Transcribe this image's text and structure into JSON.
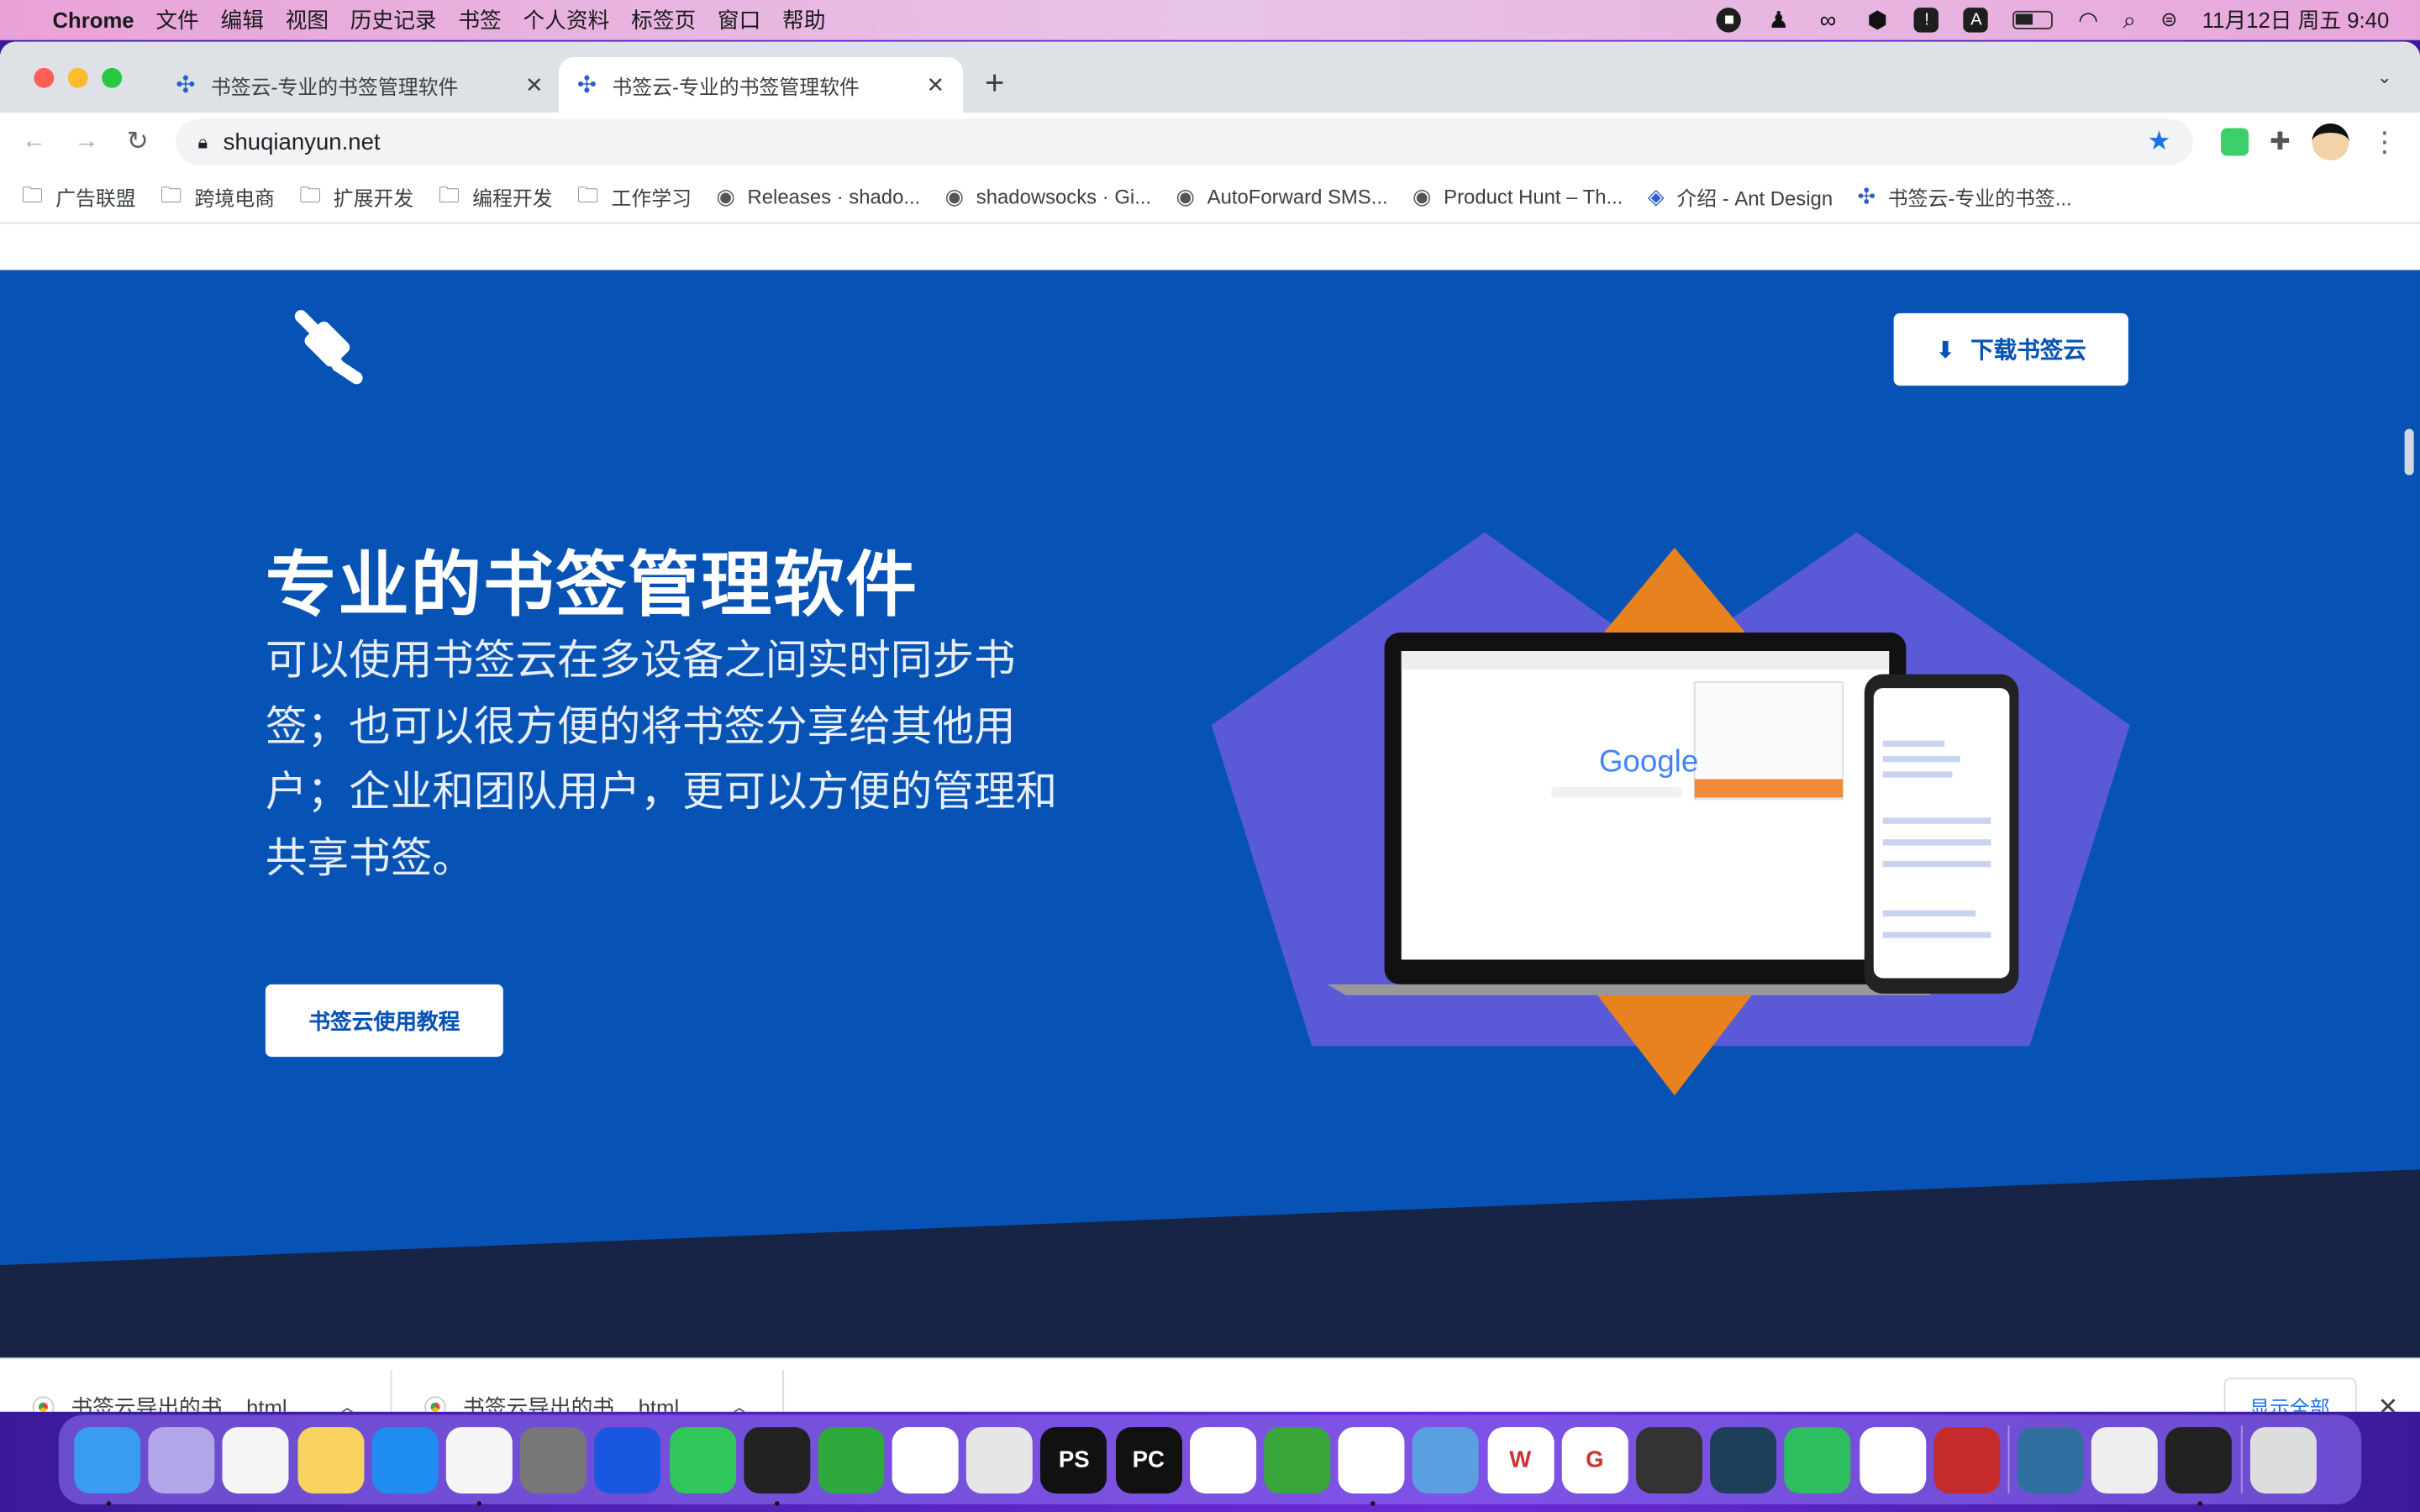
{
  "menubar": {
    "app": "Chrome",
    "items": [
      "文件",
      "编辑",
      "视图",
      "历史记录",
      "书签",
      "个人资料",
      "标签页",
      "窗口",
      "帮助"
    ],
    "clock": "11月12日 周五 9:40",
    "status_icons": [
      "record-icon",
      "qq-icon",
      "creative-cloud-icon",
      "hexagon-icon",
      "alert-icon",
      "input-method-icon",
      "battery-icon",
      "wifi-icon",
      "search-icon",
      "control-center-icon"
    ]
  },
  "tabs": [
    {
      "title": "书签云-专业的书签管理软件",
      "active": false
    },
    {
      "title": "书签云-专业的书签管理软件",
      "active": true
    }
  ],
  "toolbar": {
    "url": "shuqianyun.net"
  },
  "bookmarks": [
    {
      "label": "广告联盟",
      "type": "folder"
    },
    {
      "label": "跨境电商",
      "type": "folder"
    },
    {
      "label": "扩展开发",
      "type": "folder"
    },
    {
      "label": "编程开发",
      "type": "folder"
    },
    {
      "label": "工作学习",
      "type": "folder"
    },
    {
      "label": "Releases · shado...",
      "type": "globe"
    },
    {
      "label": "shadowsocks · Gi...",
      "type": "globe"
    },
    {
      "label": "AutoForward SMS...",
      "type": "globe"
    },
    {
      "label": "Product Hunt – Th...",
      "type": "globe"
    },
    {
      "label": "介绍 - Ant Design",
      "type": "ant"
    },
    {
      "label": "书签云-专业的书签...",
      "type": "shuqianyun"
    }
  ],
  "page": {
    "download_button": "下载书签云",
    "title": "专业的书签管理软件",
    "description": "可以使用书签云在多设备之间实时同步书签；也可以很方便的将书签分享给其他用户；企业和团队用户，更可以方便的管理和共享书签。",
    "tutorial_button": "书签云使用教程",
    "mockup_text": "Google",
    "colors": {
      "primary": "#0753b5",
      "dark": "#172445",
      "accent": "#e8821e",
      "shape": "#5a5ad8"
    }
  },
  "downloads": {
    "items": [
      "书签云导出的书....html",
      "书签云导出的书....html"
    ],
    "show_all": "显示全部"
  },
  "dock": [
    {
      "name": "finder",
      "color": "#3a9cf0",
      "running": true
    },
    {
      "name": "launchpad",
      "color": "#b3a6e8"
    },
    {
      "name": "reminders",
      "color": "#f5f5f5"
    },
    {
      "name": "notes",
      "color": "#f7d25c"
    },
    {
      "name": "app-store",
      "color": "#1e8cf0"
    },
    {
      "name": "chrome",
      "color": "#f5f5f5",
      "running": true
    },
    {
      "name": "system-preferences",
      "color": "#777"
    },
    {
      "name": "maps-pin",
      "color": "#1957e0"
    },
    {
      "name": "wechat",
      "color": "#2fc75a"
    },
    {
      "name": "qq",
      "color": "#222",
      "running": true
    },
    {
      "name": "h-editor",
      "color": "#2eaa3c"
    },
    {
      "name": "xcode-instruments",
      "color": "#fff"
    },
    {
      "name": "messages-terminal",
      "color": "#e6e6e6"
    },
    {
      "name": "phpstorm",
      "color": "#111",
      "label": "PS"
    },
    {
      "name": "pycharm",
      "color": "#111",
      "label": "PC"
    },
    {
      "name": "vscode",
      "color": "#fff"
    },
    {
      "name": "paper-plane",
      "color": "#3aa53a"
    },
    {
      "name": "baidu-netdisk",
      "color": "#fff",
      "running": true
    },
    {
      "name": "remote-desktop",
      "color": "#5aa0e0"
    },
    {
      "name": "wps",
      "color": "#fff",
      "label": "W"
    },
    {
      "name": "g-app",
      "color": "#fff",
      "label": "G"
    },
    {
      "name": "sublime-text",
      "color": "#333"
    },
    {
      "name": "mysql-workbench",
      "color": "#1d3f5a"
    },
    {
      "name": "evernote",
      "color": "#2dbe60"
    },
    {
      "name": "music-app",
      "color": "#fff"
    },
    {
      "name": "parallels",
      "color": "#c52b2b"
    },
    {
      "name": "sequel-pro",
      "color": "#2e6fa0"
    },
    {
      "name": "usb-tool",
      "color": "#eee"
    },
    {
      "name": "quicktime",
      "color": "#222",
      "running": true
    },
    {
      "name": "trash",
      "color": "#ddd"
    }
  ]
}
